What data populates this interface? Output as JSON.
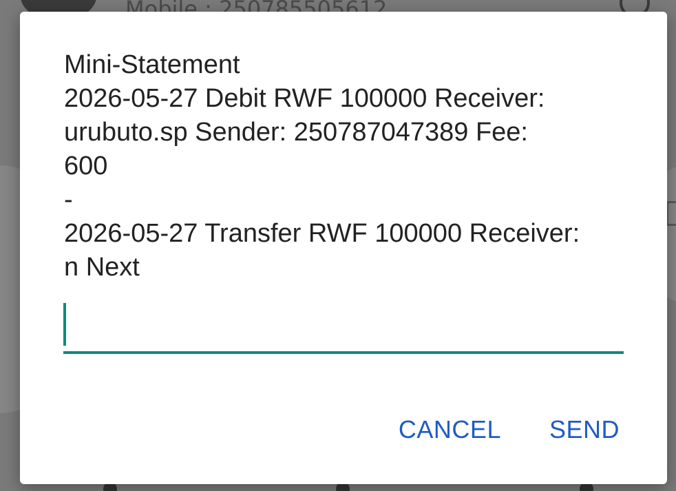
{
  "background": {
    "header_text": "Mobile : 250785505612"
  },
  "dialog": {
    "message": "Mini-Statement\n2026-05-27 Debit RWF 100000 Receiver:\nurubuto.sp Sender: 250787047389 Fee:\n600\n-\n2026-05-27 Transfer RWF 100000 Receiver:\nn Next",
    "input": {
      "value": "",
      "placeholder": ""
    },
    "buttons": {
      "cancel_label": "CANCEL",
      "send_label": "SEND"
    }
  },
  "colors": {
    "accent": "#0f8a7a",
    "button_text": "#1f5bc4",
    "scrim": "#7a7a7a"
  }
}
